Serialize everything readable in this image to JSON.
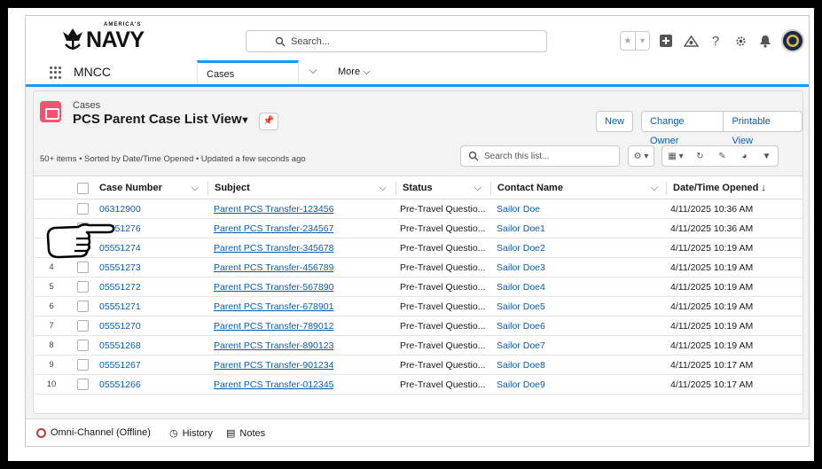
{
  "header": {
    "logo_text": "NAVY",
    "logo_small": "AMERICA'S",
    "search_placeholder": "Search..."
  },
  "nav": {
    "app_name": "MNCC",
    "active_tab": "Cases",
    "more_label": "More"
  },
  "list": {
    "object_label": "Cases",
    "title": "PCS Parent Case List View",
    "meta": "50+ items • Sorted by Date/Time Opened • Updated a few seconds ago",
    "search_placeholder": "Search this list...",
    "buttons": {
      "new": "New",
      "change_owner": "Change Owner",
      "printable_view": "Printable View"
    }
  },
  "columns": {
    "case_number": "Case Number",
    "subject": "Subject",
    "status": "Status",
    "contact_name": "Contact Name",
    "date_opened": "Date/Time Opened ↓"
  },
  "rows": [
    {
      "n": "1",
      "case": "06312900",
      "subject": "Parent PCS Transfer-123456",
      "status": "Pre-Travel Questio...",
      "contact": "Sailor Doe",
      "date": "4/11/2025 10:36 AM"
    },
    {
      "n": "2",
      "case": "05551276",
      "subject": "Parent PCS Transfer-234567",
      "status": "Pre-Travel Questio...",
      "contact": "Sailor Doe1",
      "date": "4/11/2025 10:36 AM"
    },
    {
      "n": "3",
      "case": "05551274",
      "subject": "Parent PCS Transfer-345678",
      "status": "Pre-Travel Questio...",
      "contact": "Sailor Doe2",
      "date": "4/11/2025 10:19 AM"
    },
    {
      "n": "4",
      "case": "05551273",
      "subject": "Parent PCS Transfer-456789",
      "status": "Pre-Travel Questio...",
      "contact": "Sailor Doe3",
      "date": "4/11/2025 10:19 AM"
    },
    {
      "n": "5",
      "case": "05551272",
      "subject": "Parent PCS Transfer-567890",
      "status": "Pre-Travel Questio...",
      "contact": "Sailor Doe4",
      "date": "4/11/2025 10:19 AM"
    },
    {
      "n": "6",
      "case": "05551271",
      "subject": "Parent PCS Transfer-678901",
      "status": "Pre-Travel Questio...",
      "contact": "Sailor Doe5",
      "date": "4/11/2025 10:19 AM"
    },
    {
      "n": "7",
      "case": "05551270",
      "subject": "Parent PCS Transfer-789012",
      "status": "Pre-Travel Questio...",
      "contact": "Sailor Doe6",
      "date": "4/11/2025 10:19 AM"
    },
    {
      "n": "8",
      "case": "05551268",
      "subject": "Parent PCS Transfer-890123",
      "status": "Pre-Travel Questio...",
      "contact": "Sailor Doe7",
      "date": "4/11/2025 10:19 AM"
    },
    {
      "n": "9",
      "case": "05551267",
      "subject": "Parent PCS Transfer-901234",
      "status": "Pre-Travel Questio...",
      "contact": "Sailor Doe8",
      "date": "4/11/2025 10:17 AM"
    },
    {
      "n": "10",
      "case": "05551266",
      "subject": "Parent PCS Transfer-012345",
      "status": "Pre-Travel Questio...",
      "contact": "Sailor Doe9",
      "date": "4/11/2025 10:17 AM"
    }
  ],
  "footer": {
    "omni": "Omni-Channel (Offline)",
    "history": "History",
    "notes": "Notes"
  }
}
